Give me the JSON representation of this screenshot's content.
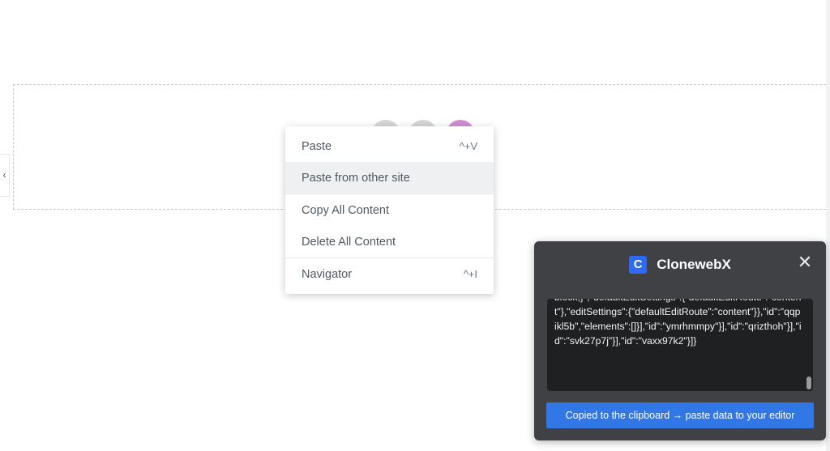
{
  "editor": {
    "collapse_toggle": "‹"
  },
  "context_menu": {
    "items": [
      {
        "label": "Paste",
        "shortcut": "^+V"
      },
      {
        "label": "Paste from other site",
        "shortcut": ""
      },
      {
        "label": "Copy All Content",
        "shortcut": ""
      },
      {
        "label": "Delete All Content",
        "shortcut": ""
      },
      {
        "label": "Navigator",
        "shortcut": "^+I"
      }
    ]
  },
  "clone_panel": {
    "logo_letter": "C",
    "title": "ClonewebX",
    "close_symbol": "✕",
    "code_text": "block;}\",\"defaultEditSettings\":{\"defaultEditRoute\":\"content\"},\"editSettings\":{\"defaultEditRoute\":\"content\"}},\"id\":\"qqpikl5b\",\"elements\":[]}],\"id\":\"ymrhmmpy\"}],\"id\":\"qrizthoh\"}],\"id\":\"svk27p7j\"}],\"id\":\"vaxx97k2\"}]}",
    "copy_button_label": "Copied to the clipboard → paste data to your editor"
  },
  "colors": {
    "accent": "#3178e6",
    "panel_bg": "#3f4144",
    "code_bg": "#1e2022",
    "add_circle_pink": "#d38bd6"
  }
}
